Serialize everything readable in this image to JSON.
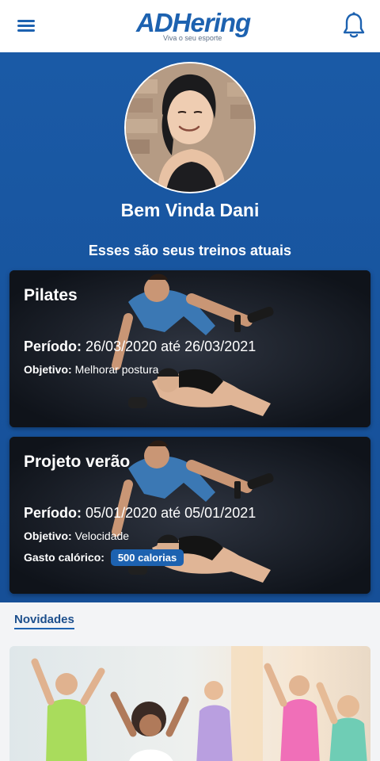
{
  "header": {
    "logo_text": "ADHering",
    "logo_tagline": "Viva o seu esporte",
    "menu_icon": "hamburger-menu-icon",
    "bell_icon": "bell-icon"
  },
  "profile": {
    "welcome": "Bem Vinda Dani",
    "subtitle": "Esses são seus treinos atuais"
  },
  "workouts": [
    {
      "title": "Pilates",
      "period_label": "Período:",
      "period_value": "26/03/2020 até 26/03/2021",
      "objective_label": "Objetivo:",
      "objective_value": "Melhorar postura"
    },
    {
      "title": "Projeto verão",
      "period_label": "Período:",
      "period_value": "05/01/2020 até 05/01/2021",
      "objective_label": "Objetivo:",
      "objective_value": "Velocidade",
      "calorie_label": "Gasto calórico:",
      "calorie_value": "500 calorias"
    }
  ],
  "news": {
    "label": "Novidades"
  },
  "colors": {
    "brand_blue": "#1d62b0",
    "hero_blue": "#1a5aa6",
    "background": "#f3f4f6"
  }
}
